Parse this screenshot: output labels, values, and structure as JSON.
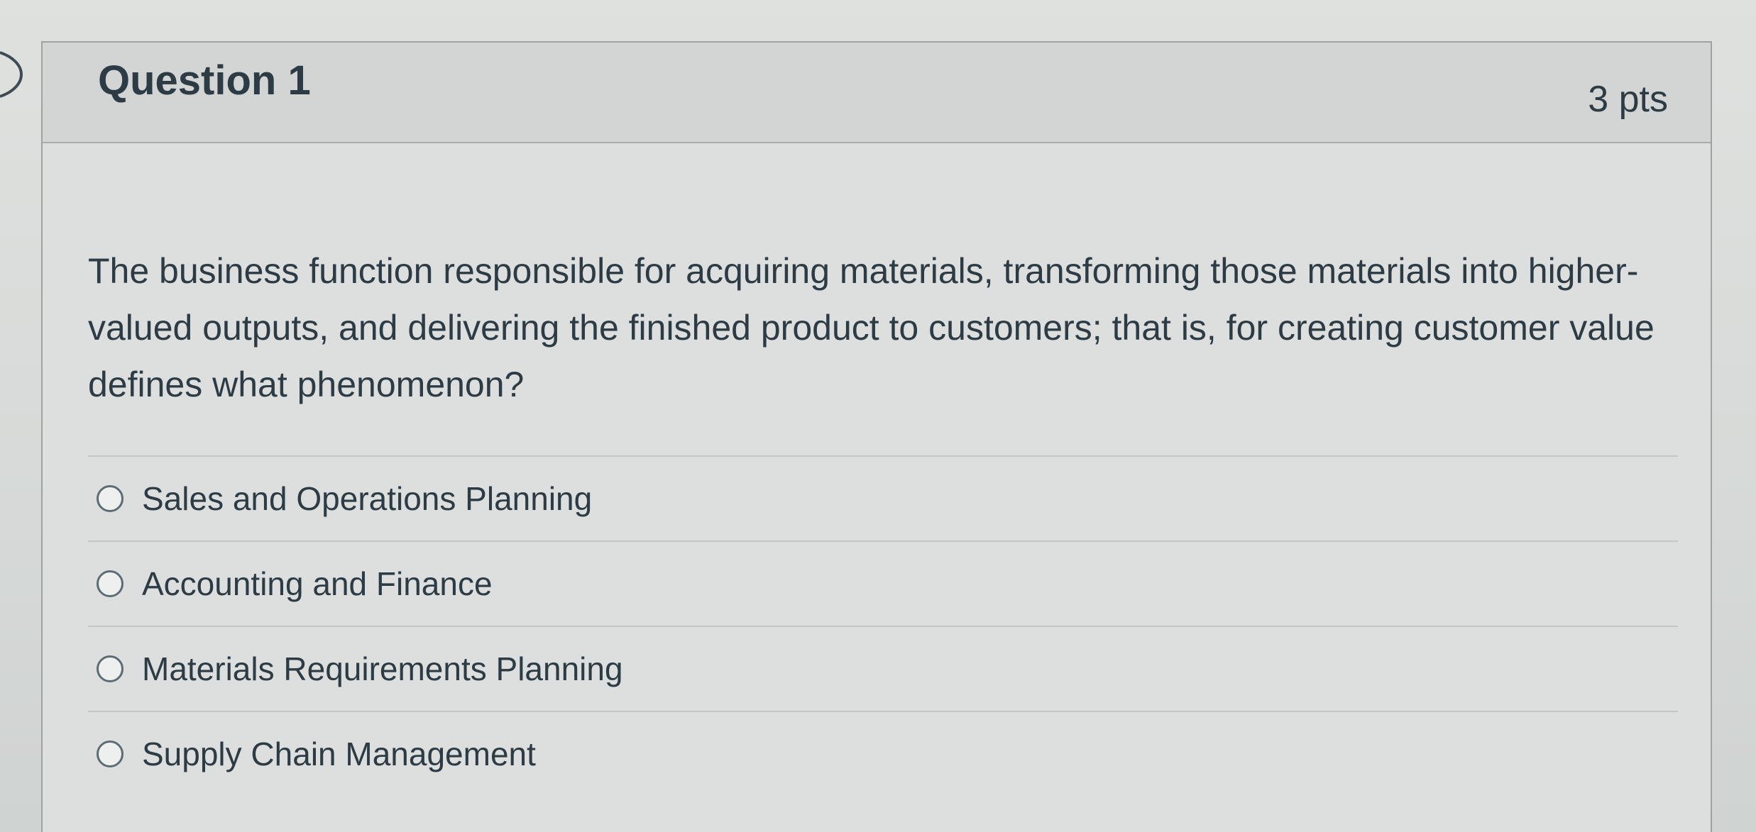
{
  "question": {
    "title": "Question 1",
    "points": "3 pts",
    "text": "The business function responsible for acquiring materials, transforming those materials into higher-valued outputs, and delivering the finished product to customers; that is, for creating customer value defines what phenomenon?"
  },
  "answers": [
    {
      "label": "Sales and Operations Planning",
      "selected": false
    },
    {
      "label": "Accounting and Finance",
      "selected": false
    },
    {
      "label": "Materials Requirements Planning",
      "selected": false
    },
    {
      "label": "Supply Chain Management",
      "selected": false
    }
  ],
  "icons": {
    "collapse": "chevron-right-icon",
    "radio": "radio-button-unselected-icon"
  },
  "colors": {
    "text": "#2d3b45",
    "header_background": "#d2d5d3",
    "border": "#9ea3a1"
  }
}
